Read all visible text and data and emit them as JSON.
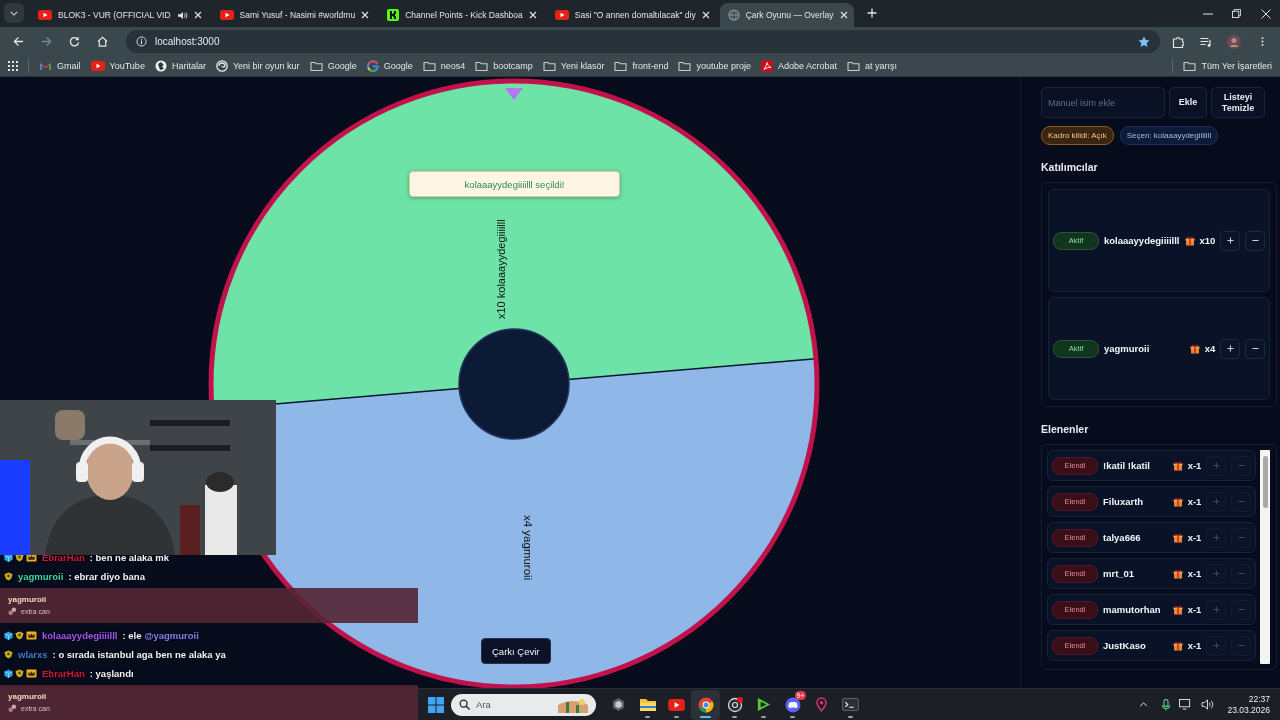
{
  "browser": {
    "tabs": [
      {
        "title": "BLOK3 - VUR (OFFICIAL VID",
        "kind": "youtube",
        "audio": true,
        "selected": false
      },
      {
        "title": "Sami Yusuf - Nasimi #worldmu",
        "kind": "youtube",
        "audio": false,
        "selected": false
      },
      {
        "title": "Channel Points - Kick Dashboa",
        "kind": "kick",
        "audio": false,
        "selected": false
      },
      {
        "title": "Sasi \"O annen domaltılacak\" diy",
        "kind": "youtube",
        "audio": false,
        "selected": false
      },
      {
        "title": "Çark Oyunu — Overlay",
        "kind": "globe",
        "audio": false,
        "selected": true
      }
    ],
    "address": "localhost:3000",
    "bookmarked": true,
    "bookmarks": [
      {
        "label": "Gmail",
        "kind": "gmail"
      },
      {
        "label": "YouTube",
        "kind": "youtube"
      },
      {
        "label": "Haritalar",
        "kind": "maps"
      },
      {
        "label": "Yeni bir oyun kur",
        "kind": "site"
      },
      {
        "label": "Google",
        "kind": "folder"
      },
      {
        "label": "Google",
        "kind": "google"
      },
      {
        "label": "neos4",
        "kind": "folder"
      },
      {
        "label": "bootcamp",
        "kind": "folder"
      },
      {
        "label": "Yeni klasör",
        "kind": "folder"
      },
      {
        "label": "front-end",
        "kind": "folder"
      },
      {
        "label": "youtube proje",
        "kind": "folder"
      },
      {
        "label": "Adobe Acrobat",
        "kind": "pdf"
      },
      {
        "label": "at yarışı",
        "kind": "folder"
      }
    ],
    "all_bookmarks": "Tüm Yer İşaretleri"
  },
  "wheel": {
    "segments": [
      {
        "label": "x10 kolaaayydegiiiilll",
        "color": "#6ee3a8"
      },
      {
        "label": "x4 yagmuroii",
        "color": "#8fb8e8"
      }
    ],
    "toast": "kolaaayydegiiiilll seçildi!",
    "spin_button": "Çarkı Çevir"
  },
  "panel": {
    "name_input": {
      "placeholder": "Manuel isim ekle"
    },
    "add_button": "Ekle",
    "clear_button": "Listeyi Temizle",
    "chips": [
      {
        "text": "Kadro kilidi: Açık",
        "kind": "lock"
      },
      {
        "text": "Seçen: kolaaayydegiiiilll",
        "kind": "picker"
      }
    ],
    "participants_title": "Katılımcılar",
    "participants": [
      {
        "status": "Aktif",
        "eliminated": false,
        "name": "kolaaayydegiiiilll",
        "count": "x10"
      },
      {
        "status": "Aktif",
        "eliminated": false,
        "name": "yagmuroii",
        "count": "x4"
      }
    ],
    "eliminated_title": "Elenenler",
    "eliminated": [
      {
        "status": "Elendi",
        "eliminated": true,
        "name": "!katil !katil",
        "count": "x-1"
      },
      {
        "status": "Elendi",
        "eliminated": true,
        "name": "Filuxarth",
        "count": "x-1"
      },
      {
        "status": "Elendi",
        "eliminated": true,
        "name": "talya666",
        "count": "x-1"
      },
      {
        "status": "Elendi",
        "eliminated": true,
        "name": "mrt_01",
        "count": "x-1"
      },
      {
        "status": "Elendi",
        "eliminated": true,
        "name": "mamutorhan",
        "count": "x-1"
      },
      {
        "status": "Elendi",
        "eliminated": true,
        "name": "JustKaso",
        "count": "x-1"
      }
    ]
  },
  "chat": [
    {
      "kind": "message",
      "badges": [
        {
          "kind": "cube"
        },
        {
          "kind": "shield"
        },
        {
          "kind": "crown"
        }
      ],
      "user": "EbrarHan",
      "color": "#d0193a",
      "text": ": ben ne alaka mk"
    },
    {
      "kind": "message",
      "badges": [
        {
          "kind": "shield"
        }
      ],
      "user": "yagmuroii",
      "color": "#3fd8a8",
      "text": ": ebrar diyo bana"
    },
    {
      "kind": "reward",
      "user": "yagmuroii",
      "reward": "extra can"
    },
    {
      "kind": "message",
      "badges": [
        {
          "kind": "cube"
        },
        {
          "kind": "shield"
        },
        {
          "kind": "crown"
        }
      ],
      "user": "kolaaayydegiiiilll",
      "color": "#a855f7",
      "text": ": ele",
      "mention": "@yagmuroii"
    },
    {
      "kind": "message",
      "badges": [
        {
          "kind": "shield"
        }
      ],
      "user": "wlarxs",
      "color": "#3a7bd5",
      "text": ": o sırada istanbul aga ben ne alaka ya"
    },
    {
      "kind": "message",
      "badges": [
        {
          "kind": "cube"
        },
        {
          "kind": "shield"
        },
        {
          "kind": "crown"
        }
      ],
      "user": "EbrarHan",
      "color": "#d0193a",
      "text": ": yaşlandı"
    },
    {
      "kind": "reward",
      "user": "yagmuroii",
      "reward": "extra can"
    }
  ],
  "taskbar": {
    "search_placeholder": "Ara",
    "apps": [
      {
        "kind": "cube",
        "running": false,
        "selected": false
      },
      {
        "kind": "folder",
        "running": true,
        "selected": false
      },
      {
        "kind": "youtube",
        "running": true,
        "selected": false
      },
      {
        "kind": "browser",
        "running": true,
        "selected": true
      },
      {
        "kind": "record",
        "running": true,
        "selected": false
      },
      {
        "kind": "play",
        "running": true,
        "selected": false
      },
      {
        "kind": "chat",
        "running": true,
        "selected": false,
        "badge": "9+"
      },
      {
        "kind": "pin",
        "running": false,
        "selected": false
      },
      {
        "kind": "terminal",
        "running": true,
        "selected": false
      }
    ],
    "time": "22:37",
    "date": "23.03.2026"
  }
}
